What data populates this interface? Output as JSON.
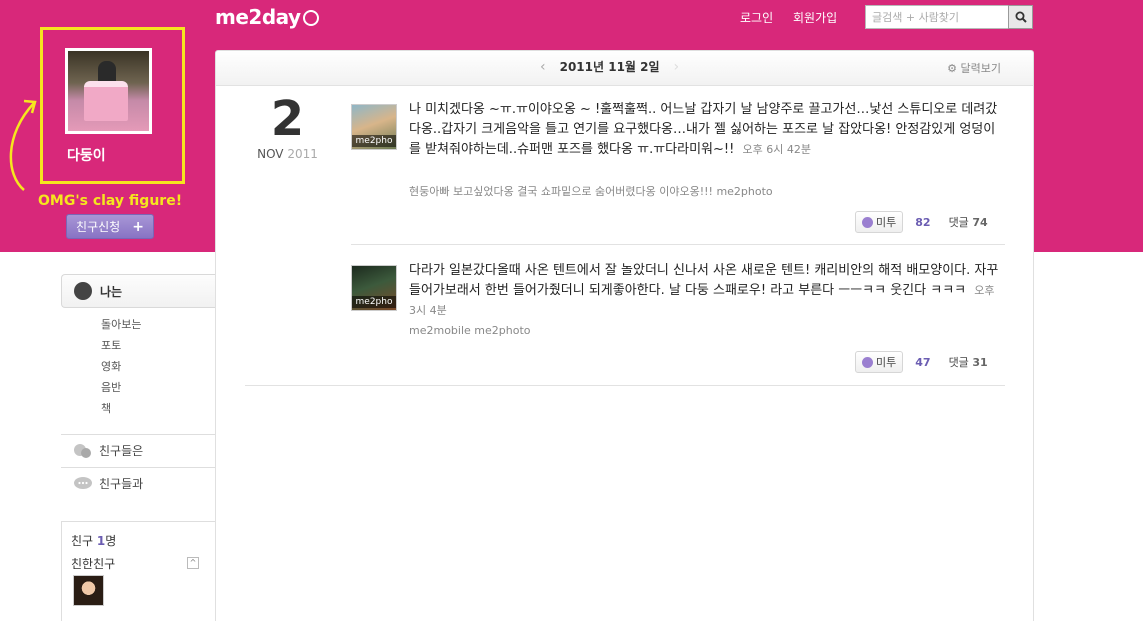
{
  "app": {
    "logo": "me2day",
    "nav": {
      "login": "로그인",
      "signup": "회원가입"
    },
    "search": {
      "placeholder": "글검색 + 사람찾기"
    }
  },
  "profile": {
    "name": "다둥이",
    "annotation": "OMG's clay figure!",
    "friend_request_label": "친구신청",
    "friend_request_plus": "+"
  },
  "sidebar": {
    "me_label": "나는",
    "sub_items": [
      "돌아보는",
      "포토",
      "영화",
      "음반",
      "책"
    ],
    "friends_of": "친구들은",
    "friends_with": "친구들과",
    "friend_count_prefix": "친구",
    "friend_count": "1",
    "friend_count_unit": "명",
    "close_friends": "친한친구",
    "toggle": "^"
  },
  "timeline": {
    "date_title": "2011년 11월 2일",
    "prev": "‹",
    "next": "›",
    "calendar_label": "달력보기",
    "big_day": "2",
    "big_month": "NOV",
    "big_year": "2011"
  },
  "posts": [
    {
      "thumb_label": "me2pho",
      "body": "나 미치겠다옹 ~ㅠ.ㅠ이야오옹 ~ !훌쩍훌쩍.. 어느날 갑자기 날 남양주로 끌고가선…낯선 스튜디오로 데려갔다옹..갑자기 크게음악을 틀고 연기를 요구했다옹…내가 젤 싫어하는 포즈로 날 잡았다옹! 안정감있게 엉덩이를 받쳐줘야하는데..슈퍼맨 포즈를 했다옹 ㅠ.ㅠ다라미워~!!",
      "time": "오후 6시 42분",
      "tags": "현둥아빠 보고싶었다옹 결국 쇼파밑으로 숨어버렸다옹 이야오옹!!! me2photo",
      "metoo_label": "미투",
      "metoo_count": "82",
      "comment_label": "댓글",
      "comment_count": "74"
    },
    {
      "thumb_label": "me2pho",
      "body": "다라가 일본갔다올때 사온 텐트에서 잘 놀았더니 신나서 사온 새로운 텐트! 캐리비안의 해적 배모양이다. 자꾸 들어가보래서 한번 들어가줬더니 되게좋아한다. 날 다둥 스패로우! 라고 부른다 ㅡㅡㅋㅋ 웃긴다 ㅋㅋㅋ",
      "time": "오후 3시 4분",
      "tags": "me2mobile me2photo",
      "metoo_label": "미투",
      "metoo_count": "47",
      "comment_label": "댓글",
      "comment_count": "31"
    }
  ],
  "colors": {
    "brand_pink": "#d8287a",
    "highlight_yellow": "#f5e61e",
    "metoo_purple": "#8873c4"
  }
}
